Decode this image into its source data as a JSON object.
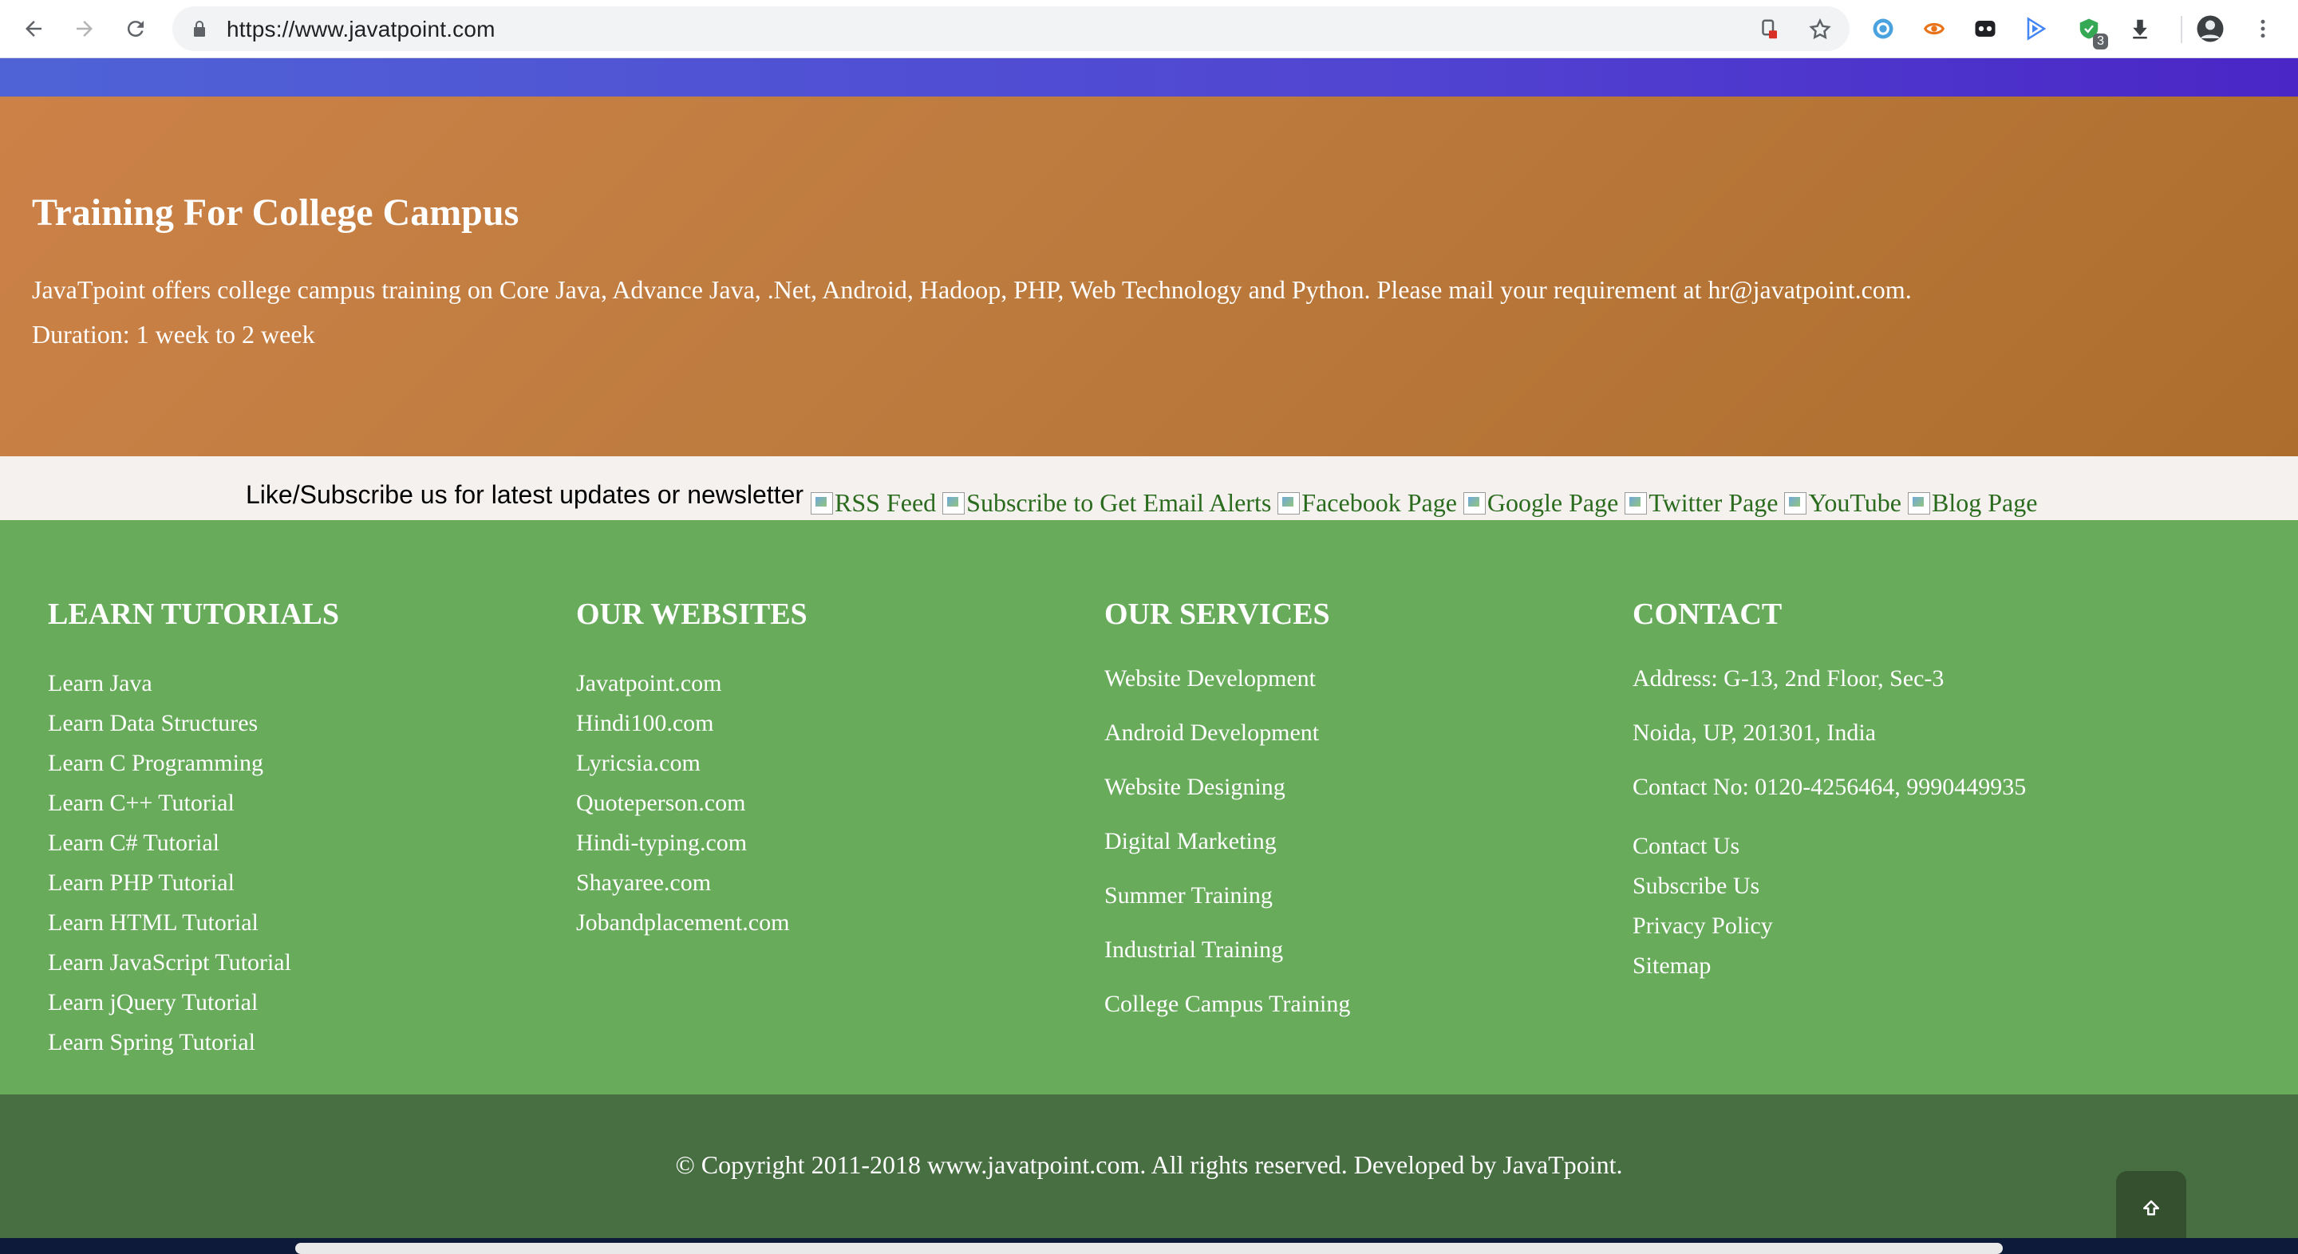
{
  "browser": {
    "url": "https://www.javatpoint.com",
    "extensions": [
      "grammarly-icon",
      "tampermonkey-icon",
      "ghostery-icon",
      "google-play-icon",
      "shield-extension-icon",
      "download-icon",
      "profile-avatar-icon"
    ],
    "shield_badge": "3"
  },
  "hero": {
    "title": "Training For College Campus",
    "description": "JavaTpoint offers college campus training on Core Java, Advance Java, .Net, Android, Hadoop, PHP, Web Technology and Python. Please mail your requirement at hr@javatpoint.com.",
    "duration": "Duration: 1 week to 2 week"
  },
  "subscribe": {
    "label": "Like/Subscribe us for latest updates or newsletter",
    "links": [
      "RSS Feed",
      "Subscribe to Get Email Alerts",
      "Facebook Page",
      "Google Page",
      "Twitter Page",
      "YouTube",
      "Blog Page"
    ]
  },
  "footer": {
    "learn": {
      "heading": "LEARN TUTORIALS",
      "items": [
        "Learn Java",
        "Learn Data Structures",
        "Learn C Programming",
        "Learn C++ Tutorial",
        "Learn C# Tutorial",
        "Learn PHP Tutorial",
        "Learn HTML Tutorial",
        "Learn JavaScript Tutorial",
        "Learn jQuery Tutorial",
        "Learn Spring Tutorial"
      ]
    },
    "websites": {
      "heading": "OUR WEBSITES",
      "items": [
        "Javatpoint.com",
        "Hindi100.com",
        "Lyricsia.com",
        "Quoteperson.com",
        "Hindi-typing.com",
        "Shayaree.com",
        "Jobandplacement.com"
      ]
    },
    "services": {
      "heading": "OUR SERVICES",
      "items": [
        "Website Development",
        "Android Development",
        "Website Designing",
        "Digital Marketing",
        "Summer Training",
        "Industrial Training",
        "College Campus Training"
      ]
    },
    "contact": {
      "heading": "CONTACT",
      "address1": "Address: G-13, 2nd Floor, Sec-3",
      "address2": "Noida, UP, 201301, India",
      "phone": "Contact No: 0120-4256464, 9990449935",
      "links": [
        "Contact Us",
        "Subscribe Us",
        "Privacy Policy",
        "Sitemap"
      ]
    }
  },
  "copyright": "© Copyright 2011-2018 www.javatpoint.com. All rights reserved. Developed by JavaTpoint.",
  "colors": {
    "hero": "#c07a3f",
    "footer": "#68ab5b",
    "copyright_bar": "#476f42",
    "topbar": "#4f55d4",
    "link_green": "#2a6b1e"
  }
}
